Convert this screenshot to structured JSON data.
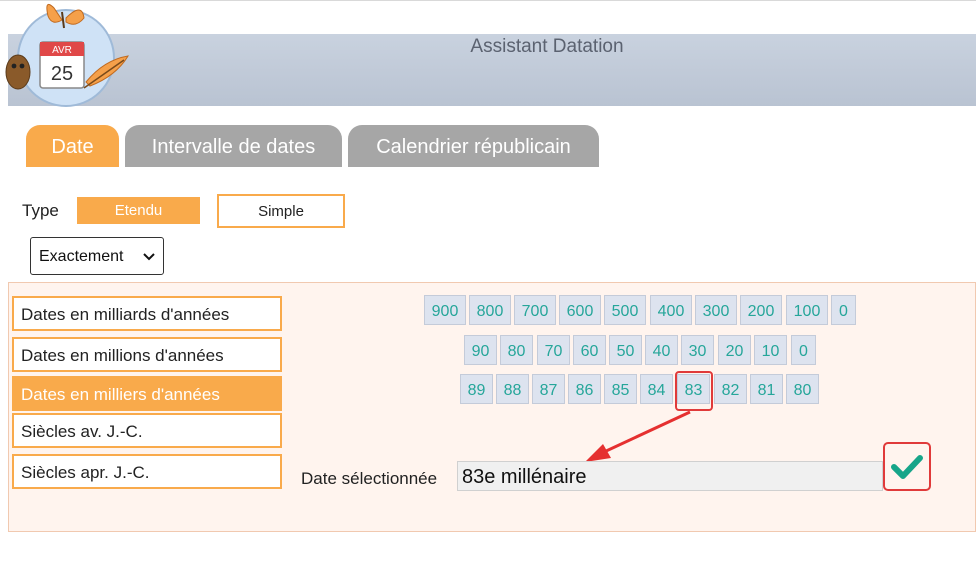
{
  "header": {
    "title": "Assistant Datation",
    "logo_calendar_month": "AVR",
    "logo_calendar_day": "25"
  },
  "tabs": [
    {
      "label": "Date",
      "active": true
    },
    {
      "label": "Intervalle de dates",
      "active": false
    },
    {
      "label": "Calendrier républicain",
      "active": false
    }
  ],
  "type": {
    "label": "Type",
    "options": [
      "Etendu",
      "Simple"
    ],
    "selected": "Etendu"
  },
  "precision": {
    "value": "Exactement"
  },
  "categories": [
    "Dates en milliards d'années",
    "Dates en millions d'années",
    "Dates en milliers d'années",
    "Siècles av. J.-C.",
    "Siècles apr. J.-C."
  ],
  "active_category": "Dates en milliers d'années",
  "numbers": {
    "row1": [
      "900",
      "800",
      "700",
      "600",
      "500",
      "400",
      "300",
      "200",
      "100",
      "0"
    ],
    "row2": [
      "90",
      "80",
      "70",
      "60",
      "50",
      "40",
      "30",
      "20",
      "10",
      "0"
    ],
    "row3": [
      "89",
      "88",
      "87",
      "86",
      "85",
      "84",
      "83",
      "82",
      "81",
      "80"
    ]
  },
  "highlighted": "83",
  "selected_date": {
    "label": "Date sélectionnée",
    "value": "83e millénaire"
  },
  "colors": {
    "accent": "#f9aa4b",
    "tab_inactive": "#a6a6a6",
    "number_text": "#26a69a",
    "highlight": "#e03a3a",
    "check": "#17a589"
  },
  "icons": {
    "confirm": "check-icon",
    "dropdown": "chevron-down-icon"
  }
}
